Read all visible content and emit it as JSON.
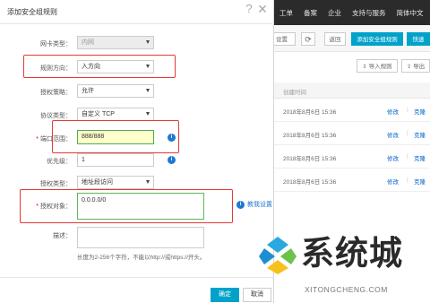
{
  "modal": {
    "title": "添加安全组规则",
    "help_glyph": "?",
    "close_glyph": "✕",
    "fields": {
      "nic_type": {
        "label": "网卡类型：",
        "value": "内网"
      },
      "direction": {
        "label": "规则方向：",
        "value": "入方向"
      },
      "policy": {
        "label": "授权策略：",
        "value": "允许"
      },
      "protocol": {
        "label": "协议类型：",
        "value": "自定义 TCP"
      },
      "port_range": {
        "label": "端口范围：",
        "value": "888/888"
      },
      "priority": {
        "label": "优先级：",
        "value": "1"
      },
      "auth_type": {
        "label": "授权类型：",
        "value": "地址段访问"
      },
      "auth_object": {
        "label": "授权对象：",
        "value": "0.0.0.0/0"
      },
      "description": {
        "label": "描述：",
        "hint": "长度为2-256个字符，不能以http://或https://开头。"
      }
    },
    "required_mark": "*",
    "tutorial_link": "教我设置",
    "confirm_label": "确定",
    "cancel_label": "取消"
  },
  "background": {
    "top_nav": [
      "工单",
      "备案",
      "企业",
      "支持与服务",
      "简体中文"
    ],
    "toolbar": {
      "set_label": "设置",
      "refresh_glyph": "⟳",
      "back_label": "返回",
      "add_rule_label": "添加安全组规则",
      "quick_label": "快速"
    },
    "import_label": "导入规则",
    "export_label": "导出",
    "table_header": "创建时间",
    "rows": [
      {
        "time": "2018年8月6日 15:36",
        "edit": "修改",
        "clone": "克隆"
      },
      {
        "time": "2018年8月6日 15:36",
        "edit": "修改",
        "clone": "克隆"
      },
      {
        "time": "2018年8月6日 15:36",
        "edit": "修改",
        "clone": "克隆"
      },
      {
        "time": "2018年8月6日 15:36",
        "edit": "修改",
        "clone": "克隆"
      }
    ],
    "separator": "|"
  },
  "watermark": {
    "text": "系统城",
    "sub": "XITONGCHENG.COM"
  },
  "colors": {
    "primary": "#00a2ca",
    "highlight_border": "#e53935",
    "link": "#1f78d1",
    "input_ok": "#5cb85c"
  }
}
